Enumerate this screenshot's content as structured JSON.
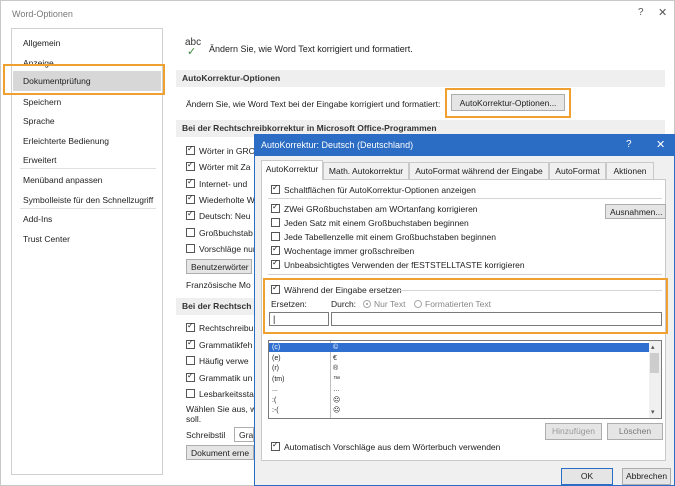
{
  "outer": {
    "title": "Word-Optionen",
    "help": "?",
    "close": "✕",
    "sidebar": [
      "Allgemein",
      "Anzeige",
      "Dokumentprüfung",
      "Speichern",
      "Sprache",
      "Erleichterte Bedienung",
      "Erweitert",
      "Menüband anpassen",
      "Symbolleiste für den Schnellzugriff",
      "Add-Ins",
      "Trust Center"
    ],
    "selected_index": 2,
    "intro_icon": "abc",
    "intro_text": "Ändern Sie, wie Word Text korrigiert und formatiert.",
    "section1": "AutoKorrektur-Optionen",
    "ak_row_label": "Ändern Sie, wie Word Text bei der Eingabe korrigiert und formatiert:",
    "ak_button": "AutoKorrektur-Optionen...",
    "section2": "Bei der Rechtschreibkorrektur in Microsoft Office-Programmen",
    "opts2": [
      {
        "label": "Wörter in GRO",
        "checked": true
      },
      {
        "label": "Wörter mit Za",
        "checked": true
      },
      {
        "label": "Internet- und",
        "checked": true
      },
      {
        "label": "Wiederholte W",
        "checked": true
      },
      {
        "label": "Deutsch: Neu",
        "checked": true
      },
      {
        "label": "Großbuchstab",
        "checked": false
      },
      {
        "label": "Vorschläge nur",
        "checked": false
      }
    ],
    "btn_benutzer": "Benutzerwörter",
    "frz_label": "Französische Mo",
    "section3": "Bei der Rechtsch",
    "opts3": [
      {
        "label": "Rechtschreibu",
        "checked": true
      },
      {
        "label": "Grammatikfeh",
        "checked": true
      },
      {
        "label": "Häufig verwe",
        "checked": false
      },
      {
        "label": "Grammatik un",
        "checked": true
      },
      {
        "label": "Lesbarkeitssta",
        "checked": false
      }
    ],
    "waehlen_text": "Wählen Sie aus, w",
    "soll_text": "soll.",
    "schreibstil_label": "Schreibstil",
    "schreibstil_value": "Gra",
    "btn_dokument": "Dokument erne"
  },
  "dialog": {
    "title": "AutoKorrektur: Deutsch (Deutschland)",
    "help": "?",
    "close": "✕",
    "tabs": [
      "AutoKorrektur",
      "Math. Autokorrektur",
      "AutoFormat während der Eingabe",
      "AutoFormat",
      "Aktionen"
    ],
    "active_tab": 0,
    "show_buttons": {
      "label": "Schaltflächen für AutoKorrektur-Optionen anzeigen",
      "checked": true
    },
    "options": [
      {
        "label": "ZWei GRoßbuchstaben am WOrtanfang korrigieren",
        "checked": true
      },
      {
        "label": "Jeden Satz mit einem Großbuchstaben beginnen",
        "checked": false
      },
      {
        "label": "Jede Tabellenzelle mit einem Großbuchstaben beginnen",
        "checked": false
      },
      {
        "label": "Wochentage immer großschreiben",
        "checked": true
      },
      {
        "label": "Unbeabsichtigtes Verwenden der fESTSTELLTASTE korrigieren",
        "checked": true
      }
    ],
    "ausnahmen": "Ausnahmen...",
    "replace_while_typing": {
      "label": "Während der Eingabe ersetzen",
      "checked": true
    },
    "ersetzen_label": "Ersetzen:",
    "durch_label": "Durch:",
    "nur_text": "Nur Text",
    "formatierten_text": "Formatierten Text",
    "list": [
      {
        "from": "(c)",
        "to": "©",
        "selected": true
      },
      {
        "from": "(e)",
        "to": "€",
        "selected": false
      },
      {
        "from": "(r)",
        "to": "®",
        "selected": false
      },
      {
        "from": "(tm)",
        "to": "™",
        "selected": false
      },
      {
        "from": "...",
        "to": "…",
        "selected": false
      },
      {
        "from": ":(",
        "to": "☹",
        "selected": false
      },
      {
        "from": ":-(",
        "to": "☹",
        "selected": false
      }
    ],
    "hinzufuegen": "Hinzufügen",
    "loeschen": "Löschen",
    "auto_suggest": {
      "label": "Automatisch Vorschläge aus dem Wörterbuch verwenden",
      "checked": true
    },
    "ok": "OK",
    "abbrechen": "Abbrechen"
  },
  "colors": {
    "accent": "#2b6cc4",
    "highlight": "#f0a030",
    "selection": "#2f6fd0"
  }
}
